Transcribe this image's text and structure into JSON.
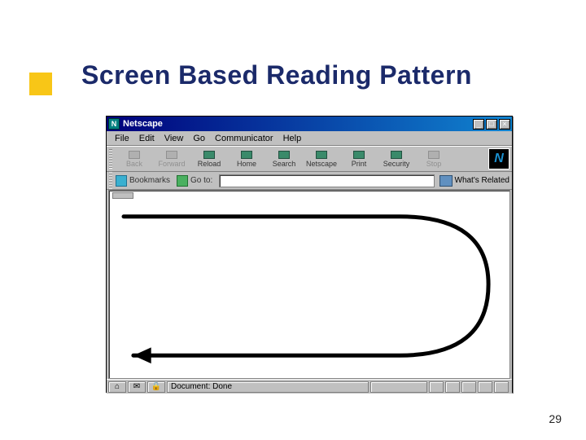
{
  "slide": {
    "title": "Screen Based Reading Pattern",
    "page_number": "29"
  },
  "window": {
    "app_name": "Netscape",
    "titlebar_icon": "N"
  },
  "win_controls": {
    "minimize": "_",
    "maximize": "□",
    "close": "×"
  },
  "menu": {
    "file": "File",
    "edit": "Edit",
    "view": "View",
    "go": "Go",
    "communicator": "Communicator",
    "help": "Help"
  },
  "toolbar": {
    "back": "Back",
    "forward": "Forward",
    "reload": "Reload",
    "home": "Home",
    "search": "Search",
    "netscape": "Netscape",
    "print": "Print",
    "security": "Security",
    "stop": "Stop"
  },
  "location": {
    "bookmarks": "Bookmarks",
    "goto_label": "Go to:",
    "url_value": "",
    "related": "What's Related"
  },
  "status": {
    "text": "Document: Done"
  }
}
